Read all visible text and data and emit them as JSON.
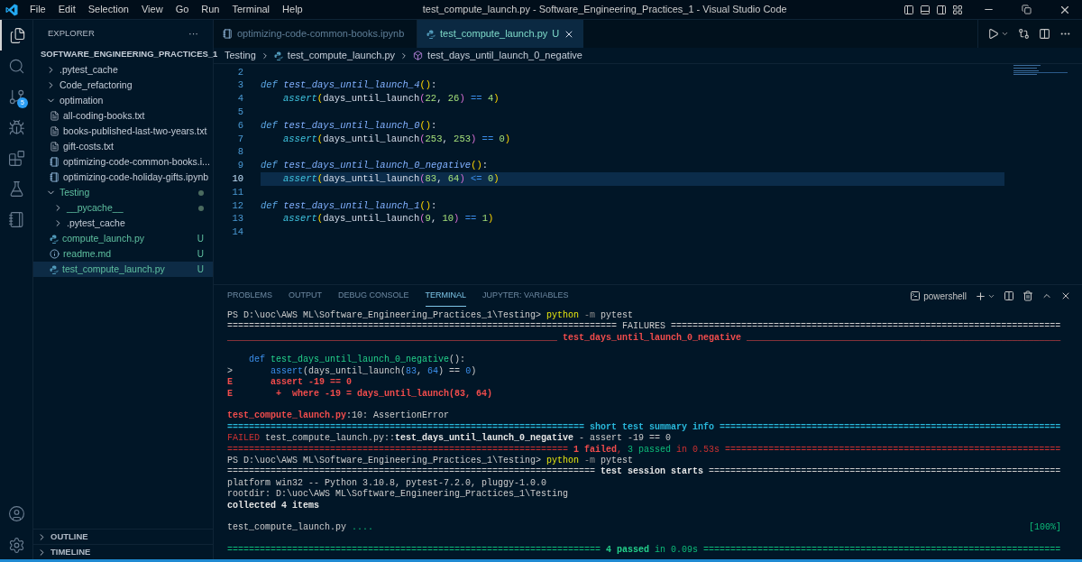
{
  "window": {
    "title": "test_compute_launch.py - Software_Engineering_Practices_1 - Visual Studio Code"
  },
  "menu": [
    "File",
    "Edit",
    "Selection",
    "View",
    "Go",
    "Run",
    "Terminal",
    "Help"
  ],
  "activity_bar": [
    {
      "kind": "files",
      "selected": true
    },
    {
      "kind": "search",
      "selected": false
    },
    {
      "kind": "source-control",
      "selected": false,
      "badge": "5"
    },
    {
      "kind": "run",
      "selected": false
    },
    {
      "kind": "extensions",
      "selected": false
    },
    {
      "kind": "testing",
      "selected": false
    },
    {
      "kind": "notebook",
      "selected": false
    }
  ],
  "sidebar": {
    "title": "EXPLORER",
    "more": "···",
    "root": "SOFTWARE_ENGINEERING_PRACTICES_1",
    "items": [
      {
        "label": ".pytest_cache",
        "kind": "folder",
        "expanded": false,
        "untracked": false
      },
      {
        "label": "Code_refactoring",
        "kind": "folder",
        "expanded": false,
        "untracked": false
      },
      {
        "label": "optimation",
        "kind": "folder",
        "expanded": true,
        "untracked": false,
        "children": [
          {
            "label": "all-coding-books.txt",
            "kind": "text",
            "untracked": false
          },
          {
            "label": "books-published-last-two-years.txt",
            "kind": "text",
            "untracked": false
          },
          {
            "label": "gift-costs.txt",
            "kind": "text",
            "untracked": false
          },
          {
            "label": "optimizing-code-common-books.i...",
            "kind": "notebook",
            "untracked": false
          },
          {
            "label": "optimizing-code-holiday-gifts.ipynb",
            "kind": "notebook",
            "untracked": false
          }
        ]
      },
      {
        "label": "Testing",
        "kind": "folder",
        "expanded": true,
        "untracked": true,
        "dot": true,
        "children": [
          {
            "label": "__pycache__",
            "kind": "folder",
            "expanded": false,
            "untracked": true,
            "dot": true
          },
          {
            "label": ".pytest_cache",
            "kind": "folder",
            "expanded": false,
            "untracked": false
          },
          {
            "label": "compute_launch.py",
            "kind": "python",
            "untracked": true,
            "status": "U"
          },
          {
            "label": "readme.md",
            "kind": "info",
            "untracked": true,
            "status": "U"
          },
          {
            "label": "test_compute_launch.py",
            "kind": "python",
            "untracked": true,
            "status": "U",
            "selected": true
          }
        ]
      }
    ],
    "sections": [
      {
        "label": "OUTLINE",
        "expanded": false
      },
      {
        "label": "TIMELINE",
        "expanded": false
      }
    ]
  },
  "tabs": [
    {
      "label": "optimizing-code-common-books.ipynb",
      "kind": "notebook",
      "selected": false
    },
    {
      "label": "test_compute_launch.py",
      "kind": "python",
      "selected": true,
      "status": "U"
    }
  ],
  "breadcrumbs": [
    {
      "label": "Testing",
      "kind": "folder"
    },
    {
      "label": "test_compute_launch.py",
      "kind": "python"
    },
    {
      "label": "test_days_until_launch_0_negative",
      "kind": "symbol"
    }
  ],
  "code": [
    {
      "number": "2",
      "selected": false
    },
    {
      "number": "3",
      "selected": false,
      "tokens": [
        {
          "t": "def ",
          "kind": "keyword"
        },
        {
          "t": "test_days_until_launch_4",
          "kind": "func"
        },
        {
          "t": "()",
          "kind": "paren"
        },
        {
          "t": ":",
          "kind": "plain"
        }
      ]
    },
    {
      "number": "4",
      "selected": false,
      "indented": true,
      "tokens": [
        {
          "t": "assert",
          "kind": "call"
        },
        {
          "t": "(",
          "kind": "paren"
        },
        {
          "t": "days_until_launch",
          "kind": "plain"
        },
        {
          "t": "(",
          "kind": "paren2"
        },
        {
          "t": "22",
          "kind": "number"
        },
        {
          "t": ", ",
          "kind": "plain"
        },
        {
          "t": "26",
          "kind": "number"
        },
        {
          "t": ")",
          "kind": "paren2"
        },
        {
          "t": " == ",
          "kind": "op"
        },
        {
          "t": "4",
          "kind": "number"
        },
        {
          "t": ")",
          "kind": "paren"
        }
      ]
    },
    {
      "number": "5",
      "selected": false
    },
    {
      "number": "6",
      "selected": false,
      "tokens": [
        {
          "t": "def ",
          "kind": "keyword"
        },
        {
          "t": "test_days_until_launch_0",
          "kind": "func"
        },
        {
          "t": "()",
          "kind": "paren"
        },
        {
          "t": ":",
          "kind": "plain"
        }
      ]
    },
    {
      "number": "7",
      "selected": false,
      "indented": true,
      "tokens": [
        {
          "t": "assert",
          "kind": "call"
        },
        {
          "t": "(",
          "kind": "paren"
        },
        {
          "t": "days_until_launch",
          "kind": "plain"
        },
        {
          "t": "(",
          "kind": "paren2"
        },
        {
          "t": "253",
          "kind": "number"
        },
        {
          "t": ", ",
          "kind": "plain"
        },
        {
          "t": "253",
          "kind": "number"
        },
        {
          "t": ")",
          "kind": "paren2"
        },
        {
          "t": " == ",
          "kind": "op"
        },
        {
          "t": "0",
          "kind": "number"
        },
        {
          "t": ")",
          "kind": "paren"
        }
      ]
    },
    {
      "number": "8",
      "selected": false
    },
    {
      "number": "9",
      "selected": false,
      "tokens": [
        {
          "t": "def ",
          "kind": "keyword"
        },
        {
          "t": "test_days_until_launch_0_negative",
          "kind": "func"
        },
        {
          "t": "()",
          "kind": "paren"
        },
        {
          "t": ":",
          "kind": "plain"
        }
      ]
    },
    {
      "number": "10",
      "selected": true,
      "indented": true,
      "tokens": [
        {
          "t": "assert",
          "kind": "call"
        },
        {
          "t": "(",
          "kind": "paren"
        },
        {
          "t": "days_until_launch",
          "kind": "plain"
        },
        {
          "t": "(",
          "kind": "paren2"
        },
        {
          "t": "83",
          "kind": "number"
        },
        {
          "t": ", ",
          "kind": "plain"
        },
        {
          "t": "64",
          "kind": "number"
        },
        {
          "t": ")",
          "kind": "paren2"
        },
        {
          "t": " <= ",
          "kind": "op"
        },
        {
          "t": "0",
          "kind": "number"
        },
        {
          "t": ")",
          "kind": "paren"
        }
      ]
    },
    {
      "number": "11",
      "selected": false
    },
    {
      "number": "12",
      "selected": false,
      "tokens": [
        {
          "t": "def ",
          "kind": "keyword"
        },
        {
          "t": "test_days_until_launch_1",
          "kind": "func"
        },
        {
          "t": "()",
          "kind": "paren"
        },
        {
          "t": ":",
          "kind": "plain"
        }
      ]
    },
    {
      "number": "13",
      "selected": false,
      "indented": true,
      "tokens": [
        {
          "t": "assert",
          "kind": "call"
        },
        {
          "t": "(",
          "kind": "paren"
        },
        {
          "t": "days_until_launch",
          "kind": "plain"
        },
        {
          "t": "(",
          "kind": "paren2"
        },
        {
          "t": "9",
          "kind": "number"
        },
        {
          "t": ", ",
          "kind": "plain"
        },
        {
          "t": "10",
          "kind": "number"
        },
        {
          "t": ")",
          "kind": "paren2"
        },
        {
          "t": " == ",
          "kind": "op"
        },
        {
          "t": "1",
          "kind": "number"
        },
        {
          "t": ")",
          "kind": "paren"
        }
      ]
    },
    {
      "number": "14",
      "selected": false
    }
  ],
  "panel": {
    "tabs": [
      {
        "label": "PROBLEMS",
        "selected": false
      },
      {
        "label": "OUTPUT",
        "selected": false
      },
      {
        "label": "DEBUG CONSOLE",
        "selected": false
      },
      {
        "label": "TERMINAL",
        "selected": true
      },
      {
        "label": "JUPYTER: VARIABLES",
        "selected": false
      }
    ],
    "shell": "powershell",
    "terminal": [
      {
        "segments": [
          {
            "t": "PS D:\\uoc\\AWS ML\\Software_Engineering_Practices_1\\Testing> ",
            "kind": "text"
          },
          {
            "t": "python",
            "kind": "command"
          },
          {
            "t": " -m",
            "kind": "flag"
          },
          {
            "t": " pytest",
            "kind": "text"
          }
        ]
      },
      {
        "segments": [
          {
            "t": "======================================================================== FAILURES ========================================================================",
            "kind": "text"
          }
        ]
      },
      {
        "segments": [
          {
            "t": "_____________________________________________________________ test_days_until_launch_0_negative __________________________________________________________",
            "kind": "error"
          }
        ]
      },
      {
        "space_before": true,
        "segments": [
          {
            "t": "    def ",
            "kind": "keyword"
          },
          {
            "t": "test_days_until_launch_0_negative",
            "kind": "func"
          },
          {
            "t": "():",
            "kind": "text"
          }
        ]
      },
      {
        "segments": [
          {
            "t": ">       ",
            "kind": "text"
          },
          {
            "t": "assert",
            "kind": "keyword"
          },
          {
            "t": "(days_until_launch(",
            "kind": "text"
          },
          {
            "t": "83",
            "kind": "number"
          },
          {
            "t": ", ",
            "kind": "text"
          },
          {
            "t": "64",
            "kind": "number"
          },
          {
            "t": ") == ",
            "kind": "text"
          },
          {
            "t": "0",
            "kind": "number"
          },
          {
            "t": ")",
            "kind": "text"
          }
        ]
      },
      {
        "segments": [
          {
            "t": "E       assert -19 == 0",
            "kind": "error"
          }
        ]
      },
      {
        "segments": [
          {
            "t": "E        +  where -19 = days_until_launch(83, 64)",
            "kind": "error"
          }
        ]
      },
      {
        "space_before": true,
        "segments": [
          {
            "t": "test_compute_launch.py",
            "kind": "error"
          },
          {
            "t": ":10: AssertionError",
            "kind": "text"
          }
        ]
      },
      {
        "segments": [
          {
            "t": "================================================================== short test summary info ===============================================================",
            "kind": "info"
          }
        ]
      },
      {
        "segments": [
          {
            "t": "FAILED",
            "kind": "fail"
          },
          {
            "t": " test_compute_launch.py::",
            "kind": "text"
          },
          {
            "t": "test_days_until_launch_0_negative",
            "kind": "bold"
          },
          {
            "t": " - assert -19 == 0",
            "kind": "text"
          }
        ]
      },
      {
        "segments": [
          {
            "t": "=============================================================== ",
            "kind": "fail"
          },
          {
            "t": "1 failed",
            "kind": "error"
          },
          {
            "t": ", ",
            "kind": "fail"
          },
          {
            "t": "3 passed",
            "kind": "pass"
          },
          {
            "t": " in 0.53s ==============================================================",
            "kind": "fail"
          }
        ]
      },
      {
        "segments": [
          {
            "t": "PS D:\\uoc\\AWS ML\\Software_Engineering_Practices_1\\Testing> ",
            "kind": "text"
          },
          {
            "t": "python",
            "kind": "command"
          },
          {
            "t": " -m",
            "kind": "flag"
          },
          {
            "t": " pytest",
            "kind": "text"
          }
        ]
      },
      {
        "segments": [
          {
            "t": "==================================================================== ",
            "kind": "text"
          },
          {
            "t": "test session starts",
            "kind": "bold"
          },
          {
            "t": " =================================================================",
            "kind": "text"
          }
        ]
      },
      {
        "segments": [
          {
            "t": "platform win32 -- Python 3.10.8, pytest-7.2.0, pluggy-1.0.0",
            "kind": "text"
          }
        ]
      },
      {
        "segments": [
          {
            "t": "rootdir: D:\\uoc\\AWS ML\\Software_Engineering_Practices_1\\Testing",
            "kind": "text"
          }
        ]
      },
      {
        "segments": [
          {
            "t": "collected 4 items",
            "kind": "bold"
          }
        ]
      },
      {
        "space_before": true,
        "segments": [
          {
            "t": "test_compute_launch.py ",
            "kind": "text"
          },
          {
            "t": "....",
            "kind": "pass"
          }
        ],
        "right": "[100%]"
      },
      {
        "space_before": true,
        "segments": [
          {
            "t": "===================================================================== ",
            "kind": "pass"
          },
          {
            "t": "4 passed",
            "kind": "passbold"
          },
          {
            "t": " in 0.09s ==================================================================",
            "kind": "pass"
          }
        ]
      }
    ]
  }
}
